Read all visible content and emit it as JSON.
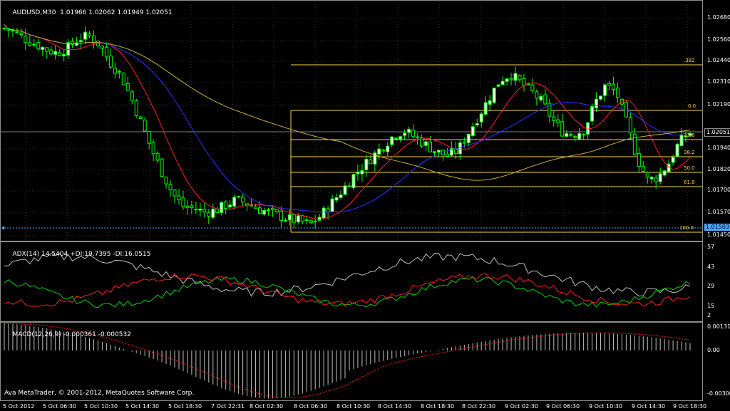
{
  "main_chart": {
    "symbol_line": "AUDUSD,M30  1.01966 1.02062 1.01949 1.02051",
    "price_axis": [
      "1.02680",
      "1.02560",
      "1.02440",
      "1.02310",
      "1.02190",
      "1.01940",
      "1.01820",
      "1.01700",
      "1.01570",
      "1.01450"
    ],
    "current_price": "1.02051",
    "low_marker": "1.01503",
    "fib_levels": [
      {
        "label": ".382"
      },
      {
        "label": "0.0"
      },
      {
        "label": "23.6"
      },
      {
        "label": "38.2"
      },
      {
        "label": "50.0"
      },
      {
        "label": "61.8"
      },
      {
        "label": "100.0"
      }
    ]
  },
  "adx": {
    "info": "ADX(14) 14.5404 +DI:19.7395 -DI:16.0515",
    "axis": [
      "57",
      "43",
      "29",
      "15",
      "2"
    ]
  },
  "macd": {
    "info": "MACD(12,26,9) -0.000361 -0.000532",
    "axis": [
      "0.00131",
      "0.00",
      "-0.00300"
    ]
  },
  "time_axis": [
    "5 Oct 2012",
    "5 Oct 06:30",
    "5 Oct 10:30",
    "5 Oct 14:30",
    "5 Oct 18:30",
    "7 Oct 22:31",
    "8 Oct 02:30",
    "8 Oct 06:30",
    "8 Oct 10:30",
    "8 Oct 14:30",
    "8 Oct 18:30",
    "8 Oct 22:30",
    "9 Oct 02:30",
    "9 Oct 06:30",
    "9 Oct 10:30",
    "9 Oct 14:30",
    "9 Oct 18:30"
  ],
  "copyright": "Ava MetaTrader, © 2001-2012, MetaQuotes Software Corp.",
  "colors": {
    "bull_candle": "#ffffff",
    "bear_candle": "#000000",
    "wick": "#00ff00",
    "ma_fast": "#ff2020",
    "ma_mid": "#3030ff",
    "ma_slow": "#c8b040",
    "fib": "#ffd24a",
    "adx": "#c0c0c0",
    "plus_di": "#00d000",
    "minus_di": "#ff2020",
    "macd_hist": "#c0c0c0",
    "macd_signal": "#ff2020",
    "price_tag": "#4da6ff"
  },
  "chart_data": {
    "type": "candlestick",
    "symbol": "AUDUSD",
    "timeframe": "M30",
    "ohlc_last": {
      "open": 1.01966,
      "high": 1.02062,
      "low": 1.01949,
      "close": 1.02051
    },
    "price_range": [
      1.0145,
      1.0275
    ],
    "close_series": [
      1.0264,
      1.0262,
      1.0258,
      1.0255,
      1.0252,
      1.025,
      1.0253,
      1.0258,
      1.026,
      1.0255,
      1.0245,
      1.0238,
      1.0225,
      1.021,
      1.0195,
      1.0182,
      1.017,
      1.0163,
      1.0162,
      1.016,
      1.0161,
      1.0164,
      1.0167,
      1.0165,
      1.0162,
      1.016,
      1.0158,
      1.0156,
      1.0155,
      1.0153,
      1.0158,
      1.0165,
      1.0172,
      1.018,
      1.0186,
      1.0192,
      1.0198,
      1.0204,
      1.0206,
      1.0202,
      1.0198,
      1.0194,
      1.0192,
      1.0195,
      1.0205,
      1.0215,
      1.0225,
      1.0235,
      1.0238,
      1.0233,
      1.0228,
      1.0222,
      1.0212,
      1.0205,
      1.0204,
      1.0207,
      1.0222,
      1.0232,
      1.0228,
      1.021,
      1.019,
      1.0178,
      1.018,
      1.0188,
      1.02,
      1.0205
    ],
    "fibonacci": {
      "0.0": 1.02212,
      "23.6": 1.02048,
      "38.2": 1.01946,
      "50.0": 1.01864,
      "61.8": 1.01782,
      "100.0": 1.01513,
      "-38.2": 1.02478
    }
  }
}
